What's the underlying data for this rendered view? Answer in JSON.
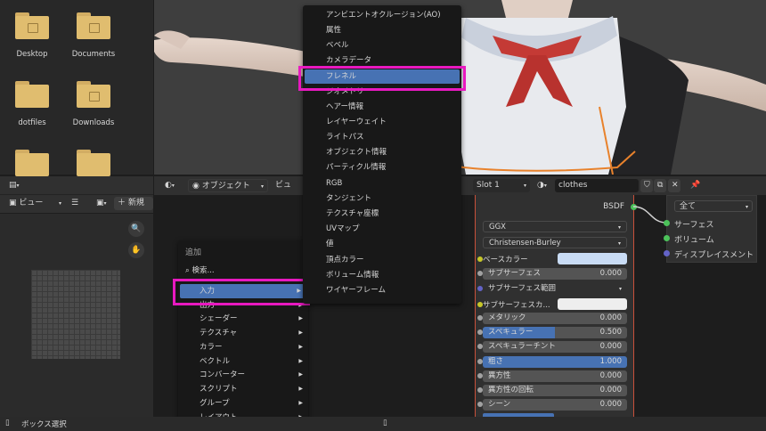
{
  "file_browser": {
    "folders": [
      {
        "label": "Desktop",
        "icon": "desktop-folder-icon"
      },
      {
        "label": "Documents",
        "icon": "documents-folder-icon"
      },
      {
        "label": "dotfiles",
        "icon": "folder-icon"
      },
      {
        "label": "Downloads",
        "icon": "downloads-folder-icon"
      },
      {
        "label": "",
        "icon": "folder-icon"
      },
      {
        "label": "",
        "icon": "folder-icon"
      }
    ]
  },
  "image_editor": {
    "view_label": "ビュー",
    "new_label": "新規"
  },
  "node_editor": {
    "mode_label": "オブジェクト",
    "view_label": "ビュー",
    "slot_label": "Slot 1",
    "material_name": "clothes"
  },
  "bsdf_node": {
    "output_label": "BSDF",
    "distribution": "GGX",
    "subsurface_method": "Christensen-Burley",
    "rows": [
      {
        "label": "ベースカラー",
        "value": "",
        "type": "color",
        "color": "#c9dcf5",
        "socket": "#c7c729"
      },
      {
        "label": "サブサーフェス",
        "value": "0.000",
        "type": "num",
        "socket": "#a1a1a1"
      },
      {
        "label": "サブサーフェス範囲",
        "value": "",
        "type": "drop",
        "socket": "#6363c7"
      },
      {
        "label": "サブサーフェスカ...",
        "value": "",
        "type": "color",
        "color": "#eeeeee",
        "socket": "#c7c729"
      },
      {
        "label": "メタリック",
        "value": "0.000",
        "type": "num",
        "socket": "#a1a1a1"
      },
      {
        "label": "スペキュラー",
        "value": "0.500",
        "type": "numsel",
        "socket": "#a1a1a1"
      },
      {
        "label": "スペキュラーチント",
        "value": "0.000",
        "type": "num",
        "socket": "#a1a1a1"
      },
      {
        "label": "粗さ",
        "value": "1.000",
        "type": "full",
        "socket": "#a1a1a1"
      },
      {
        "label": "異方性",
        "value": "0.000",
        "type": "num",
        "socket": "#a1a1a1"
      },
      {
        "label": "異方性の回転",
        "value": "0.000",
        "type": "num",
        "socket": "#a1a1a1"
      },
      {
        "label": "シーン",
        "value": "0.000",
        "type": "num",
        "socket": "#a1a1a1"
      }
    ]
  },
  "output_node": {
    "target": "全て",
    "sockets": [
      "サーフェス",
      "ボリューム",
      "ディスプレイスメント"
    ]
  },
  "add_menu": {
    "title": "追加",
    "search": "検索...",
    "items": [
      "入力",
      "出力",
      "シェーダー",
      "テクスチャ",
      "カラー",
      "ベクトル",
      "コンバーター",
      "スクリプト",
      "グループ",
      "レイアウト"
    ]
  },
  "input_menu": {
    "items": [
      "アンビエントオクルージョン(AO)",
      "属性",
      "ベベル",
      "カメラデータ",
      "フレネル",
      "ジオメトリ",
      "ヘアー情報",
      "レイヤーウェイト",
      "ライトパス",
      "オブジェクト情報",
      "パーティクル情報",
      "RGB",
      "タンジェント",
      "テクスチャ座標",
      "UVマップ",
      "値",
      "頂点カラー",
      "ボリューム情報",
      "ワイヤーフレーム"
    ],
    "highlighted": "フレネル"
  },
  "status_bar": {
    "text": "ボックス選択"
  },
  "colors": {
    "highlight": "#4772b3",
    "annotation": "#e819c0"
  }
}
